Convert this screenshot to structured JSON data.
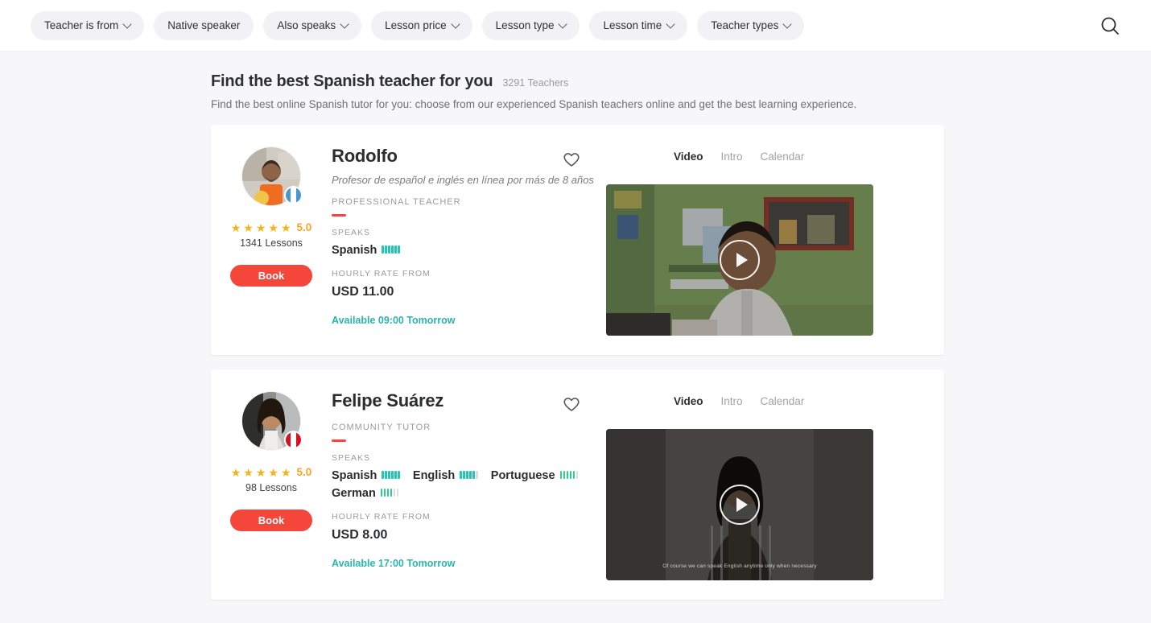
{
  "topbar": {
    "filters": [
      {
        "label": "Teacher is from",
        "has_caret": true
      },
      {
        "label": "Native speaker",
        "has_caret": false
      },
      {
        "label": "Also speaks",
        "has_caret": true
      },
      {
        "label": "Lesson price",
        "has_caret": true
      },
      {
        "label": "Lesson type",
        "has_caret": true
      },
      {
        "label": "Lesson time",
        "has_caret": true
      },
      {
        "label": "Teacher types",
        "has_caret": true
      }
    ],
    "search_icon": "search-icon"
  },
  "header": {
    "title": "Find the best Spanish teacher for you",
    "count": "3291 Teachers",
    "subtitle": "Find the best online Spanish tutor for you: choose from our experienced Spanish teachers online and get the best learning experience."
  },
  "colors": {
    "accent_red": "#f4463a",
    "teal": "#2ab5ac",
    "bar_teal": "#22c7b6",
    "bar_green": "#2ecf8e",
    "star_gold": "#f5b21d",
    "page_bg": "#f7f7fa"
  },
  "media_tabs": [
    "Video",
    "Intro",
    "Calendar"
  ],
  "teachers": [
    {
      "name": "Rodolfo",
      "tagline": "Profesor de español e inglés en línea por más de 8 años",
      "badge": "PROFESSIONAL TEACHER",
      "speaks_label": "SPEAKS",
      "languages": [
        {
          "name": "Spanish",
          "level": 6,
          "color": "teal"
        }
      ],
      "rate_label": "HOURLY RATE FROM",
      "rate": "USD 11.00",
      "availability": "Available 09:00 Tomorrow",
      "rating": "5.0",
      "stars": 5,
      "lessons": "1341 Lessons",
      "book_label": "Book",
      "flag": "guatemala-flag",
      "active_tab": "Video",
      "video_caption": ""
    },
    {
      "name": "Felipe Suárez",
      "tagline": "",
      "badge": "COMMUNITY TUTOR",
      "speaks_label": "SPEAKS",
      "languages": [
        {
          "name": "Spanish",
          "level": 6,
          "color": "teal"
        },
        {
          "name": "English",
          "level": 5,
          "color": "teal"
        },
        {
          "name": "Portuguese",
          "level": 5,
          "color": "green"
        },
        {
          "name": "German",
          "level": 4,
          "color": "green"
        }
      ],
      "rate_label": "HOURLY RATE FROM",
      "rate": "USD 8.00",
      "availability": "Available 17:00 Tomorrow",
      "rating": "5.0",
      "stars": 5,
      "lessons": "98 Lessons",
      "book_label": "Book",
      "flag": "peru-flag",
      "active_tab": "Video",
      "video_caption": "Of course we can speak English anytime only when necessary"
    }
  ]
}
